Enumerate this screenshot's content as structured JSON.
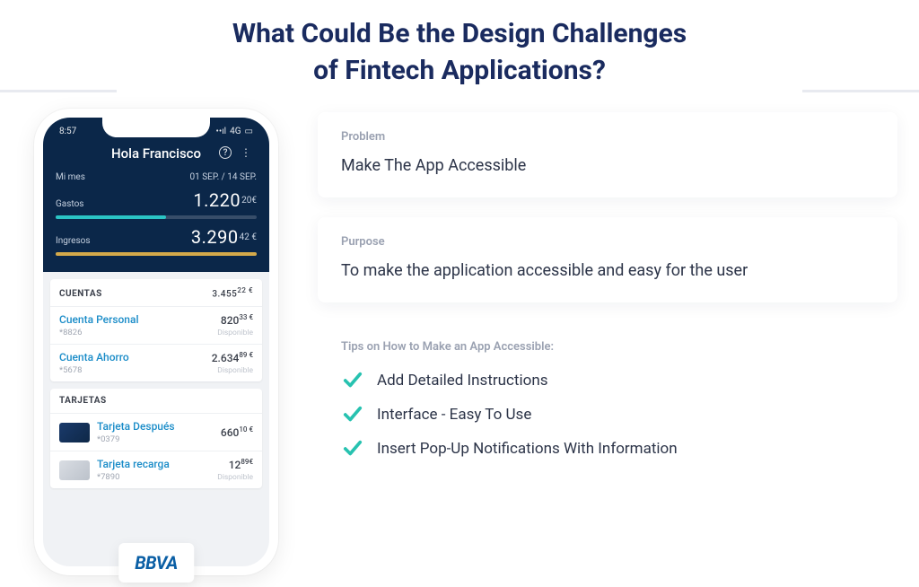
{
  "title_line1": "What Could Be the Design Challenges",
  "title_line2": "of Fintech Applications?",
  "phone": {
    "status": {
      "time": "8:57",
      "network": "4G"
    },
    "greeting": "Hola Francisco",
    "mi_mes": "Mi mes",
    "date_range": "01 SEP. / 14 SEP.",
    "gastos": {
      "label": "Gastos",
      "value": "1.220",
      "cents": "20€"
    },
    "ingresos": {
      "label": "Ingresos",
      "value": "3.290",
      "cents": "42 €"
    },
    "cuentas": {
      "header": "CUENTAS",
      "total": "3.455",
      "total_cents": "22 €",
      "rows": [
        {
          "name": "Cuenta Personal",
          "sub": "*8826",
          "amount": "820",
          "cents": "33 €",
          "disp": "Disponible"
        },
        {
          "name": "Cuenta Ahorro",
          "sub": "*5678",
          "amount": "2.634",
          "cents": "89 €",
          "disp": "Disponible"
        }
      ]
    },
    "tarjetas": {
      "header": "TARJETAS",
      "rows": [
        {
          "name": "Tarjeta Después",
          "sub": "*0379",
          "amount": "660",
          "cents": "10 €",
          "disp": ""
        },
        {
          "name": "Tarjeta recarga",
          "sub": "*7890",
          "amount": "12",
          "cents": "89€",
          "disp": "Disponible"
        }
      ]
    },
    "brand": "BBVA"
  },
  "cards": {
    "problem": {
      "label": "Problem",
      "body": "Make The App Accessible"
    },
    "purpose": {
      "label": "Purpose",
      "body": "To make the application accessible and easy for the user"
    },
    "tips": {
      "label": "Tips on How to Make an App Accessible:",
      "items": [
        "Add Detailed Instructions",
        "Interface - Easy To Use",
        "Insert Pop-Up Notifications With Information"
      ]
    }
  },
  "colors": {
    "accent_check": "#27c2b0"
  }
}
